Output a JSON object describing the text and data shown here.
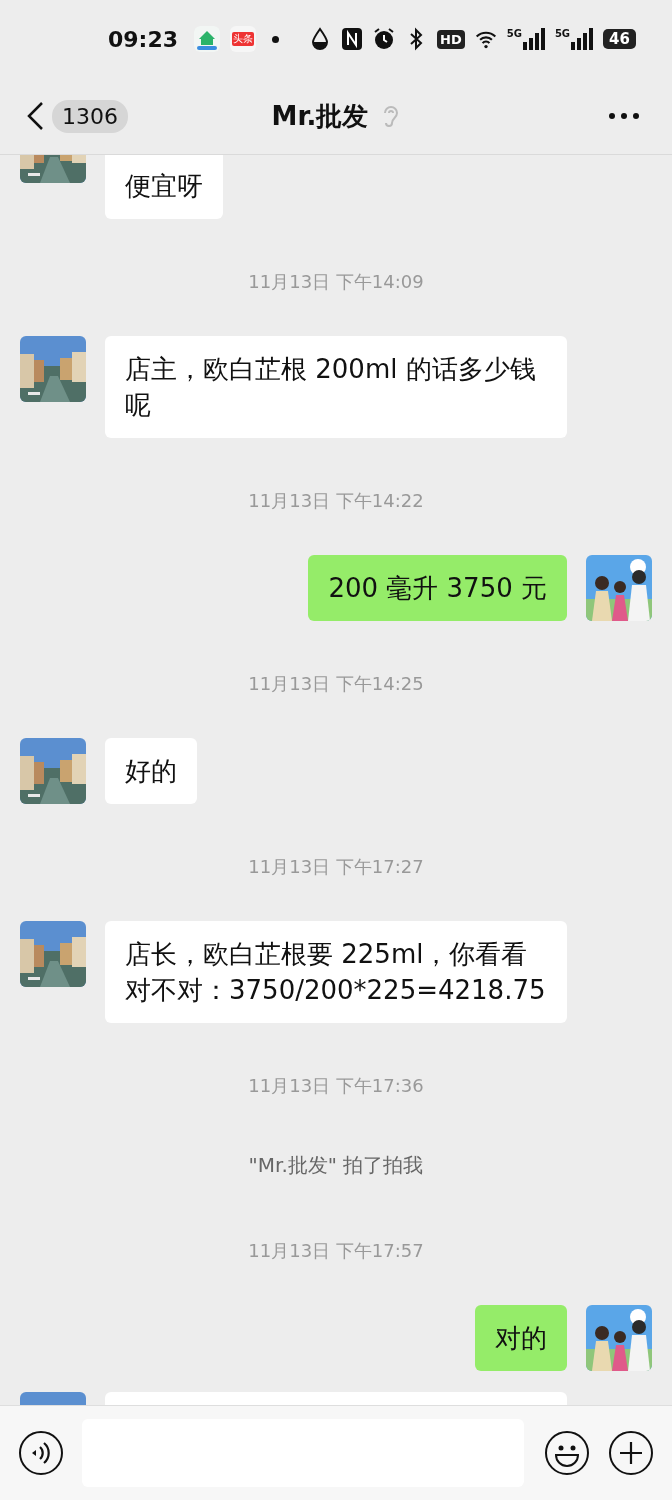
{
  "status_bar": {
    "time": "09:23",
    "app_badge": "头条",
    "hd": "HD",
    "networks": [
      "5G",
      "5G"
    ],
    "battery": "46"
  },
  "header": {
    "back_count": "1306",
    "title": "Mr.批发"
  },
  "messages": [
    {
      "kind": "incoming",
      "text": "便宜呀"
    },
    {
      "kind": "time",
      "text": "11月13日 下午14:09"
    },
    {
      "kind": "incoming",
      "text": "店主，欧白芷根 200ml 的话多少钱呢"
    },
    {
      "kind": "time",
      "text": "11月13日 下午14:22"
    },
    {
      "kind": "outgoing",
      "text": "200 毫升 3750 元"
    },
    {
      "kind": "time",
      "text": "11月13日 下午14:25"
    },
    {
      "kind": "incoming",
      "text": "好的"
    },
    {
      "kind": "time",
      "text": "11月13日 下午17:27"
    },
    {
      "kind": "incoming",
      "text": "店长，欧白芷根要 225ml，你看看对不对：3750/200*225=4218.75"
    },
    {
      "kind": "time",
      "text": "11月13日 下午17:36"
    },
    {
      "kind": "pat",
      "text": "\"Mr.批发\" 拍了拍我"
    },
    {
      "kind": "time",
      "text": "11月13日 下午17:57"
    },
    {
      "kind": "outgoing",
      "text": "对的"
    },
    {
      "kind": "incoming"
    }
  ]
}
